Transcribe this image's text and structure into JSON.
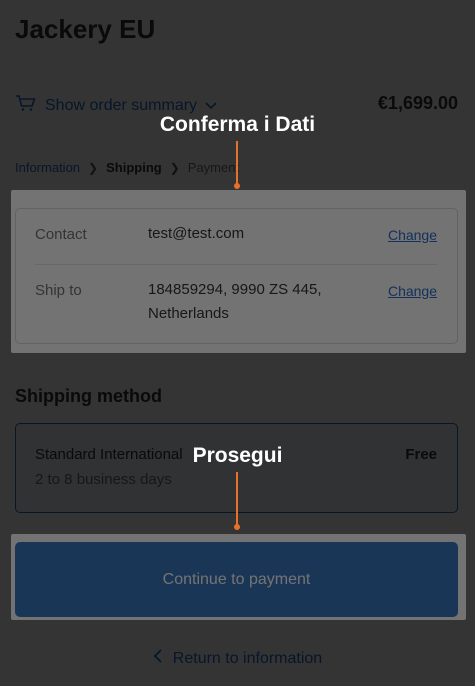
{
  "header": {
    "store_name": "Jackery EU"
  },
  "order_summary": {
    "toggle_label": "Show order summary",
    "total": "€1,699.00"
  },
  "breadcrumb": {
    "step1": "Information",
    "step2": "Shipping",
    "step3": "Payment"
  },
  "review": {
    "contact_label": "Contact",
    "contact_value": "test@test.com",
    "ship_label": "Ship to",
    "ship_line1": "184859294, 9990 ZS 445,",
    "ship_line2": "Netherlands",
    "change_label": "Change"
  },
  "shipping_method": {
    "heading": "Shipping method",
    "name": "Standard International",
    "eta": "2 to 8 business days",
    "price": "Free"
  },
  "actions": {
    "continue_label": "Continue to payment",
    "return_label": "Return to information"
  },
  "annotations": {
    "confirm": "Conferma i Dati",
    "proceed": "Prosegui"
  },
  "colors": {
    "accent": "#2c6ecb",
    "button": "#3b78bf",
    "pointer": "#e8702a"
  }
}
